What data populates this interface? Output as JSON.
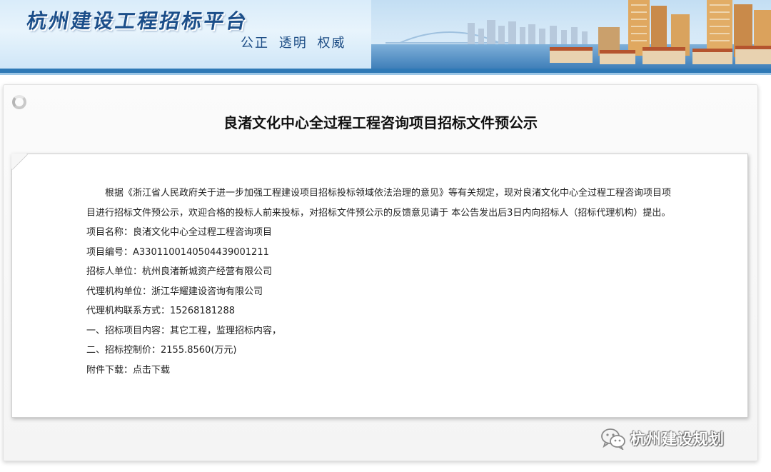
{
  "header": {
    "site_title": "杭州建设工程招标平台",
    "slogan": "公正 透明 权威"
  },
  "notice": {
    "title": "良渚文化中心全过程工程咨询项目招标文件预公示",
    "intro": "根据《浙江省人民政府关于进一步加强工程建设项目招标投标领域依法治理的意见》等有关规定，现对良渚文化中心全过程工程咨询项目项目进行招标文件预公示，欢迎合格的投标人前来投标，对招标文件预公示的反馈意见请于 本公告发出后3日内向招标人（招标代理机构）提出。",
    "project_name_label": "项目名称：",
    "project_name": "良渚文化中心全过程工程咨询项目",
    "project_code_label": "项目编号：",
    "project_code": "A3301100140504439001211",
    "tenderer_label": "招标人单位：",
    "tenderer": "杭州良渚新城资产经营有限公司",
    "agency_label": "代理机构单位：",
    "agency": "浙江华耀建设咨询有限公司",
    "agency_contact_label": "代理机构联系方式：",
    "agency_contact": "15268181288",
    "content_label": "一、招标项目内容：",
    "content": "其它工程，监理招标内容，",
    "price_label": "二、招标控制价：",
    "price": "2155.8560(万元)",
    "attachment_label": "附件下载：",
    "attachment_link": "点击下载"
  },
  "watermark": {
    "icon": "wechat-icon",
    "text": "杭州建设规划"
  },
  "colors": {
    "banner_title": "#1c4f8a",
    "banner_rule": "#2f79b6",
    "text": "#222222"
  }
}
